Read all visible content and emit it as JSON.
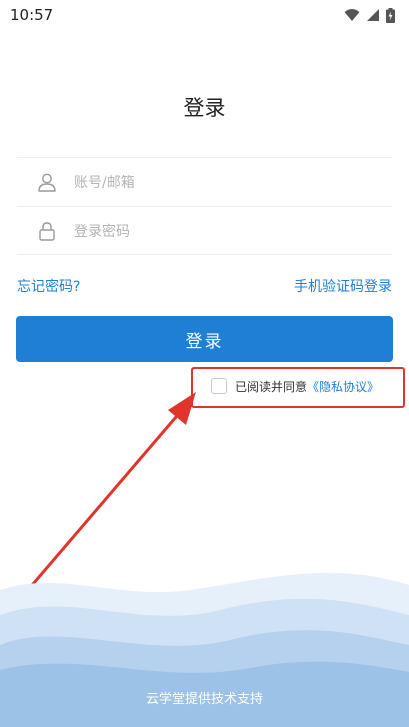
{
  "status_bar": {
    "time": "10:57",
    "icons": [
      "wifi-icon",
      "signal-icon",
      "battery-icon"
    ]
  },
  "page": {
    "title": "登录"
  },
  "form": {
    "account_placeholder": "账号/邮箱",
    "account_icon": "user-icon",
    "password_placeholder": "登录密码",
    "password_icon": "lock-icon"
  },
  "links": {
    "forgot_password": "忘记密码?",
    "sms_login": "手机验证码登录"
  },
  "login_button": {
    "label": "登录"
  },
  "agreement": {
    "text": "已阅读并同意",
    "link": "《隐私协议》"
  },
  "footer": {
    "text": "云学堂提供技术支持"
  },
  "colors": {
    "accent": "#1f7fd4",
    "link": "#1d7fd6",
    "annotation": "#e0352b"
  }
}
